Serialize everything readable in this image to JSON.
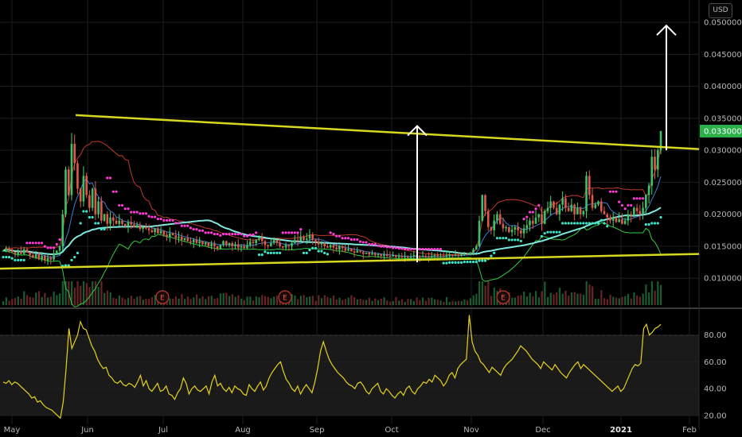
{
  "currency": "USD",
  "chart_data": {
    "type": "candlestick",
    "price_axis": {
      "ticks": [
        "0.050000",
        "0.045000",
        "0.040000",
        "0.035000",
        "0.030000",
        "0.025000",
        "0.020000",
        "0.015000",
        "0.010000"
      ],
      "range": [
        0.0058,
        0.0535
      ],
      "last_price_label": "0.033000",
      "last_price": 0.033
    },
    "oscillator_axis": {
      "ticks": [
        "80.00",
        "60.00",
        "40.00",
        "20.00"
      ],
      "range": [
        17,
        97
      ],
      "upper_band": 80,
      "lower_band": 20
    },
    "time_axis": {
      "labels": [
        "May",
        "Jun",
        "Jul",
        "Aug",
        "Sep",
        "Oct",
        "Nov",
        "Dec",
        "2021",
        "Feb"
      ],
      "bold_label": "2021"
    },
    "earnings_markers": [
      "E",
      "E",
      "E"
    ],
    "price_series": [
      0.0143,
      0.0146,
      0.0144,
      0.0141,
      0.0138,
      0.0142,
      0.0138,
      0.0145,
      0.014,
      0.0136,
      0.0132,
      0.0138,
      0.013,
      0.0135,
      0.0128,
      0.0132,
      0.0129,
      0.0138,
      0.0143,
      0.015,
      0.02,
      0.027,
      0.023,
      0.031,
      0.028,
      0.024,
      0.022,
      0.026,
      0.023,
      0.021,
      0.024,
      0.02,
      0.022,
      0.019,
      0.02,
      0.0185,
      0.0195,
      0.019,
      0.0185,
      0.019,
      0.0185,
      0.0182,
      0.0188,
      0.0184,
      0.018,
      0.0183,
      0.0177,
      0.018,
      0.0178,
      0.0175,
      0.0172,
      0.0178,
      0.017,
      0.0174,
      0.0168,
      0.0165,
      0.017,
      0.0167,
      0.0163,
      0.0165,
      0.016,
      0.0163,
      0.0158,
      0.0156,
      0.016,
      0.0155,
      0.0158,
      0.0153,
      0.0156,
      0.015,
      0.0154,
      0.015,
      0.0146,
      0.0152,
      0.0158,
      0.0152,
      0.0155,
      0.015,
      0.0153,
      0.0148,
      0.015,
      0.0147,
      0.0152,
      0.0157,
      0.0155,
      0.016,
      0.0163,
      0.0158,
      0.0152,
      0.015,
      0.0155,
      0.016,
      0.0155,
      0.015,
      0.0148,
      0.0152,
      0.015,
      0.0155,
      0.016,
      0.0158,
      0.0165,
      0.016,
      0.0162,
      0.0168,
      0.016,
      0.0158,
      0.0153,
      0.0155,
      0.015,
      0.0148,
      0.0152,
      0.0148,
      0.0145,
      0.015,
      0.0147,
      0.0143,
      0.0146,
      0.0142,
      0.014,
      0.0143,
      0.0141,
      0.0138,
      0.014,
      0.0137,
      0.0139,
      0.0136,
      0.0138,
      0.0135,
      0.0137,
      0.0135,
      0.0134,
      0.0136,
      0.0133,
      0.0135,
      0.0133,
      0.0134,
      0.0132,
      0.0134,
      0.0136,
      0.0134,
      0.0133,
      0.0135,
      0.0134,
      0.0133,
      0.0135,
      0.0136,
      0.0134,
      0.0135,
      0.0134,
      0.0136,
      0.0137,
      0.0135,
      0.0136,
      0.0135,
      0.0137,
      0.0138,
      0.0137,
      0.014,
      0.0145,
      0.015,
      0.019,
      0.023,
      0.0205,
      0.018,
      0.0175,
      0.019,
      0.02,
      0.0185,
      0.0178,
      0.018,
      0.0172,
      0.0176,
      0.018,
      0.0175,
      0.017,
      0.0178,
      0.0183,
      0.019,
      0.0185,
      0.0195,
      0.02,
      0.0185,
      0.0205,
      0.021,
      0.022,
      0.021,
      0.02,
      0.0215,
      0.0225,
      0.021,
      0.0205,
      0.0215,
      0.02,
      0.021,
      0.02,
      0.0205,
      0.026,
      0.023,
      0.021,
      0.0215,
      0.022,
      0.0205,
      0.02,
      0.0195,
      0.019,
      0.0195,
      0.0188,
      0.0192,
      0.0185,
      0.019,
      0.02,
      0.0198,
      0.021,
      0.0205,
      0.02,
      0.021,
      0.023,
      0.0245,
      0.029,
      0.027,
      0.03,
      0.033
    ],
    "oscillator_series": [
      45,
      44,
      46,
      43,
      45,
      44,
      42,
      40,
      38,
      36,
      33,
      34,
      30,
      31,
      28,
      26,
      25,
      24,
      22,
      20,
      18,
      30,
      55,
      85,
      70,
      75,
      80,
      90,
      85,
      84,
      78,
      72,
      68,
      62,
      58,
      55,
      56,
      50,
      48,
      45,
      44,
      46,
      43,
      42,
      44,
      43,
      41,
      45,
      50,
      42,
      46,
      40,
      38,
      41,
      44,
      38,
      39,
      42,
      36,
      35,
      32,
      37,
      40,
      48,
      44,
      36,
      40,
      42,
      39,
      38,
      40,
      42,
      36,
      45,
      50,
      42,
      44,
      40,
      38,
      41,
      37,
      42,
      40,
      39,
      36,
      35,
      43,
      40,
      38,
      42,
      45,
      39,
      42,
      48,
      52,
      55,
      58,
      60,
      53,
      47,
      44,
      40,
      38,
      42,
      36,
      40,
      43,
      40,
      37,
      45,
      55,
      68,
      75,
      68,
      62,
      58,
      55,
      52,
      50,
      48,
      45,
      43,
      42,
      40,
      44,
      45,
      42,
      38,
      36,
      40,
      42,
      44,
      38,
      36,
      40,
      38,
      35,
      33,
      36,
      38,
      35,
      40,
      42,
      38,
      36,
      40,
      42,
      45,
      44,
      47,
      45,
      50,
      48,
      46,
      42,
      45,
      50,
      52,
      48,
      55,
      58,
      60,
      62,
      95,
      75,
      68,
      65,
      60,
      58,
      55,
      52,
      56,
      54,
      52,
      50,
      55,
      58,
      60,
      62,
      65,
      68,
      72,
      70,
      68,
      65,
      62,
      60,
      58,
      55,
      60,
      58,
      56,
      54,
      58,
      55,
      52,
      50,
      48,
      52,
      55,
      58,
      60,
      55,
      58,
      56,
      54,
      52,
      50,
      48,
      46,
      44,
      42,
      40,
      38,
      40,
      42,
      38,
      40,
      45,
      50,
      55,
      58,
      57,
      59,
      85,
      88,
      80,
      82,
      85,
      86,
      88
    ]
  }
}
